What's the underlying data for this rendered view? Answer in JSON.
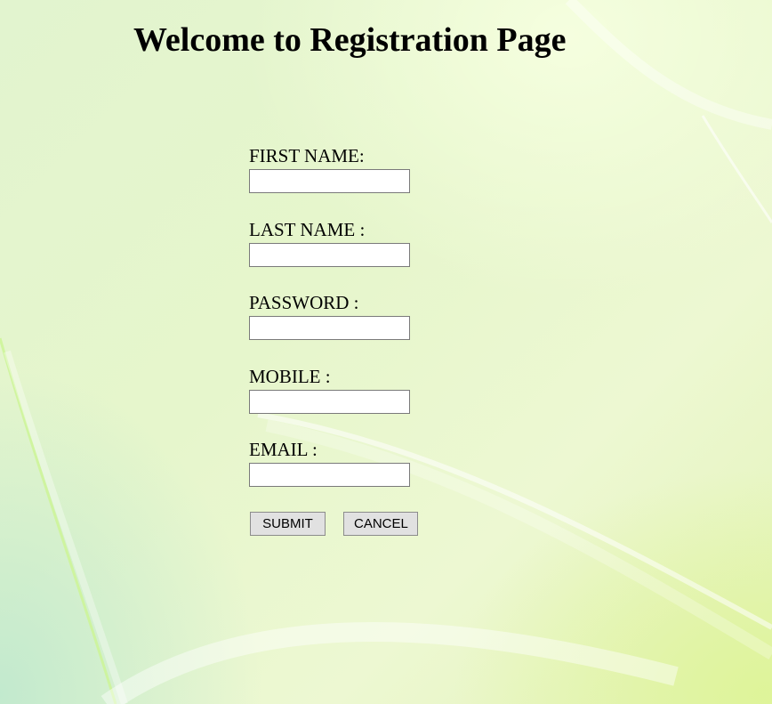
{
  "page": {
    "title": "Welcome to Registration Page"
  },
  "form": {
    "fields": [
      {
        "label": "FIRST NAME:",
        "value": "",
        "type": "text"
      },
      {
        "label": "LAST NAME :",
        "value": "",
        "type": "text"
      },
      {
        "label": "PASSWORD :",
        "value": "",
        "type": "password"
      },
      {
        "label": "MOBILE :",
        "value": "",
        "type": "text"
      },
      {
        "label": "EMAIL :",
        "value": "",
        "type": "text"
      }
    ],
    "buttons": {
      "submit_label": "SUBMIT",
      "cancel_label": "CANCEL"
    }
  },
  "colors": {
    "background_base": "#e6f6cc",
    "input_border": "#7a7a7a",
    "button_face": "#e1e1e1"
  }
}
